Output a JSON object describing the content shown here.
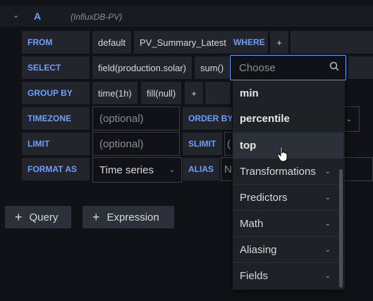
{
  "query": {
    "ref_id": "A",
    "datasource": "(InfluxDB-PV)"
  },
  "labels": {
    "from": "FROM",
    "where": "WHERE",
    "select": "SELECT",
    "group_by": "GROUP BY",
    "timezone": "TIMEZONE",
    "order_by": "ORDER BY T",
    "limit": "LIMIT",
    "slimit": "SLIMIT",
    "format_as": "FORMAT AS",
    "alias": "ALIAS"
  },
  "from": {
    "policy": "default",
    "measurement": "PV_Summary_Latest",
    "add": "+"
  },
  "select": {
    "field": "field(production.solar)",
    "func": "sum()"
  },
  "group_by": {
    "time": "time(1h)",
    "fill": "fill(null)",
    "add": "+"
  },
  "inputs": {
    "timezone_placeholder": "(optional)",
    "limit_placeholder": "(optional)",
    "slimit_partial": "(",
    "alias_partial": "N"
  },
  "format": {
    "value": "Time series"
  },
  "buttons": {
    "add_query": "Query",
    "add_expression": "Expression",
    "plus": "+"
  },
  "dropdown": {
    "search_placeholder": "Choose",
    "items": [
      {
        "label": "min"
      },
      {
        "label": "percentile"
      },
      {
        "label": "top"
      },
      {
        "label": "Transformations"
      },
      {
        "label": "Predictors"
      },
      {
        "label": "Math"
      },
      {
        "label": "Aliasing"
      },
      {
        "label": "Fields"
      }
    ]
  },
  "colors": {
    "accent": "#6e9fff",
    "background": "#111217",
    "panel": "#22252b"
  }
}
